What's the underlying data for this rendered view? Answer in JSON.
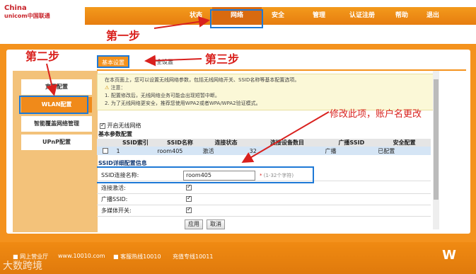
{
  "header": {
    "brand_en_line1": "China",
    "brand_en_line2": "unicom中国联通",
    "nav": [
      {
        "label": "状态"
      },
      {
        "label": "网络"
      },
      {
        "label": "安全"
      },
      {
        "label": "管理"
      },
      {
        "label": "认证注册"
      },
      {
        "label": "帮助"
      },
      {
        "label": "退出"
      }
    ]
  },
  "annotations": {
    "step1": "第一步",
    "step2": "第二步",
    "step3": "第三步",
    "note": "修改此项，账户名更改"
  },
  "sidebar": {
    "items": [
      {
        "label": "宽带配置"
      },
      {
        "label": "WLAN配置"
      },
      {
        "label": "智能覆盖网络管理"
      },
      {
        "label": "UPnP配置"
      }
    ]
  },
  "tabs": [
    {
      "label": "基本设置"
    },
    {
      "label": "安全设置"
    }
  ],
  "info": {
    "intro": "在本页面上，您可以设置无线网络参数，包括无线网络开关、SSID名称等基本配置选项。",
    "caution_title": "注意：",
    "note1": "1. 配置修改后，无线网络业务可能会出现短暂中断。",
    "note2": "2. 为了无线网络更安全，推荐您使用WPA2或者WPA/WPA2验证模式。"
  },
  "wlan": {
    "enable_label": "开启无线网络",
    "basic_section": "基本参数配置",
    "table_headers": [
      "",
      "SSID索引",
      "SSID名称",
      "连接状态",
      "连接设备数目",
      "广播SSID",
      "安全配置"
    ],
    "table_rows": [
      [
        "",
        "1",
        "room405",
        "激活",
        "32",
        "广播",
        "已配置"
      ]
    ],
    "detail_section": "SSID详细配置信息"
  },
  "form": {
    "ssid_name_label": "SSID连接名称:",
    "ssid_name_value": "room405",
    "ssid_hint_req": "*",
    "ssid_hint": "(1-32个字符)",
    "active_label": "连接激活:",
    "broadcast_label": "广播SSID:",
    "media_label": "多媒体开关:",
    "apply": "应用",
    "cancel": "取消"
  },
  "footer": {
    "hall": "网上营业厅",
    "site": "www.10010.com",
    "hotline": "客服热线10010",
    "fast": "充值专线10011",
    "watermark": "大数跨境"
  },
  "colors": {
    "accent": "#f4921d",
    "highlight": "#1e79d6",
    "annotation": "#d9211e",
    "brand": "#c8242b"
  }
}
